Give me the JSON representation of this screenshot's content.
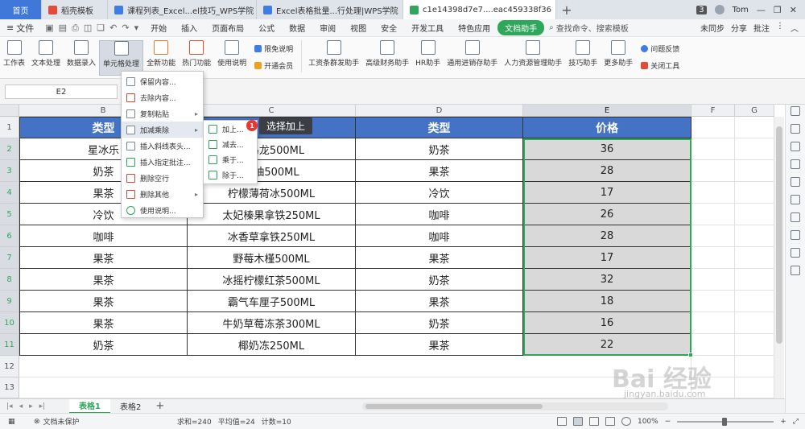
{
  "tabs": [
    {
      "label": "首页",
      "kind": "home"
    },
    {
      "label": "稻壳模板",
      "color": "#e04b3a"
    },
    {
      "label": "课程列表_Excel...el技巧_WPS学院",
      "color": "#3d7de4"
    },
    {
      "label": "Excel表格批量...行处理|WPS学院",
      "color": "#3d7de4"
    },
    {
      "label": "c1e14398d7e7....eac459338f36",
      "color": "#2fa75a",
      "active": true
    }
  ],
  "titlebar": {
    "page_counter": "3",
    "user": "Tom"
  },
  "menubar": {
    "file": "文件",
    "items": [
      "开始",
      "插入",
      "页面布局",
      "公式",
      "数据",
      "审阅",
      "视图",
      "安全",
      "开发工具",
      "特色应用",
      "文档助手"
    ],
    "active_item": "文档助手",
    "search": "查找命令、搜索模板",
    "right": [
      "未同步",
      "分享",
      "批注"
    ]
  },
  "ribbon": {
    "groups": [
      {
        "label": "工作表",
        "icon": "worksheet-icon"
      },
      {
        "label": "文本处理",
        "icon": "text-process-icon"
      },
      {
        "label": "数据录入",
        "icon": "data-entry-icon"
      },
      {
        "label": "单元格处理",
        "icon": "cell-process-icon",
        "pressed": true
      },
      {
        "label": "全新功能",
        "icon": "new-feature-icon"
      },
      {
        "label": "热门功能",
        "icon": "hot-feature-icon"
      },
      {
        "label": "使用说明",
        "icon": "manual-icon"
      }
    ],
    "small_left": [
      "限免说明",
      "开通会员"
    ],
    "tools": [
      "工资条群发助手",
      "高级财务助手",
      "HR助手",
      "通用进销存助手",
      "人力资源管理助手",
      "技巧助手",
      "更多助手"
    ],
    "small_right": [
      "问题反馈",
      "关闭工具"
    ]
  },
  "namebox": "E2",
  "columns": [
    "B",
    "C",
    "D",
    "E",
    "F",
    "G"
  ],
  "rows": [
    "1",
    "2",
    "3",
    "4",
    "5",
    "6",
    "7",
    "8",
    "9",
    "10",
    "11",
    "12",
    "13"
  ],
  "table": {
    "headers": [
      "类型",
      "",
      "类型",
      "价格"
    ],
    "rows": [
      [
        "星冰乐",
        "桃乌龙500ML",
        "奶茶",
        "36"
      ],
      [
        "奶茶",
        "红柚500ML",
        "果茶",
        "28"
      ],
      [
        "果茶",
        "柠檬薄荷冰500ML",
        "冷饮",
        "17"
      ],
      [
        "冷饮",
        "太妃榛果拿铁250ML",
        "咖啡",
        "26"
      ],
      [
        "咖啡",
        "冰香草拿铁250ML",
        "咖啡",
        "28"
      ],
      [
        "果茶",
        "野莓木槿500ML",
        "果茶",
        "17"
      ],
      [
        "果茶",
        "冰摇柠檬红茶500ML",
        "奶茶",
        "32"
      ],
      [
        "果茶",
        "霸气车厘子500ML",
        "果茶",
        "18"
      ],
      [
        "果茶",
        "牛奶草莓冻茶300ML",
        "奶茶",
        "16"
      ],
      [
        "奶茶",
        "椰奶冻250ML",
        "果茶",
        "22"
      ]
    ]
  },
  "context_menu": {
    "items": [
      {
        "label": "保留内容...",
        "submenu": false
      },
      {
        "label": "去除内容...",
        "submenu": false
      },
      {
        "label": "复制粘贴",
        "submenu": true
      },
      {
        "label": "加减乘除",
        "submenu": true,
        "highlighted": true
      },
      {
        "label": "插入斜线表头...",
        "submenu": false
      },
      {
        "label": "插入指定批注...",
        "submenu": false
      },
      {
        "label": "删除空行",
        "submenu": false
      },
      {
        "label": "删除其他",
        "submenu": true
      },
      {
        "label": "使用说明...",
        "submenu": false
      }
    ],
    "submenu": [
      "加上...",
      "减去...",
      "乘于...",
      "除于..."
    ]
  },
  "tooltip": {
    "badge": "1",
    "text": "选择加上"
  },
  "sheets": [
    {
      "label": "表格1",
      "active": true
    },
    {
      "label": "表格2",
      "active": false
    }
  ],
  "status": {
    "protect": "文档未保护",
    "sum": "求和=240",
    "avg": "平均值=24",
    "count": "计数=10",
    "zoom": "100%"
  },
  "watermark": {
    "main": "Bai 经验",
    "sub": "jingyan.baidu.com"
  },
  "colors": {
    "header_blue": "#4472c4",
    "accent_green": "#2fa75a",
    "selected_gray": "#d9d9d9"
  }
}
